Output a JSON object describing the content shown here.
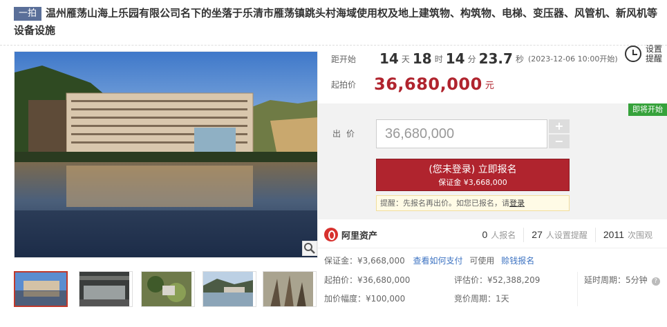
{
  "listing": {
    "tag": "一拍",
    "title": "温州雁荡山海上乐园有限公司名下的坐落于乐清市雁荡镇跳头村海域使用权及地上建筑物、构筑物、电梯、变压器、风管机、新风机等设备设施"
  },
  "countdown": {
    "label": "距开始",
    "days": "14",
    "days_unit": "天",
    "hours": "18",
    "hours_unit": "时",
    "minutes": "14",
    "minutes_unit": "分",
    "seconds": "23.7",
    "seconds_unit": "秒",
    "start_time": "(2023-12-06 10:00开始)"
  },
  "reminder": {
    "line1": "设置",
    "line2": "提醒",
    "icon": "alarm-clock-icon"
  },
  "start_price": {
    "label": "起拍价",
    "value": "36,680,000",
    "unit": "元"
  },
  "bid": {
    "badge": "即将开始",
    "label": "出价",
    "input_value": "36,680,000",
    "plus": "+",
    "minus": "−",
    "button_line1": "(您未登录) 立即报名",
    "button_line2": "保证金 ¥3,668,000",
    "notice_prefix": "提醒：先报名再出价。如您已报名，请",
    "notice_login": "登录"
  },
  "stats": {
    "logo_text": "阿里资产",
    "signups_count": "0",
    "signups_label": "人报名",
    "reminders_count": "27",
    "reminders_label": "人设置提醒",
    "views_count": "2011",
    "views_label": "次围观"
  },
  "info": {
    "deposit": "保证金：¥3,668,000",
    "how_to_pay": "查看如何支付",
    "usable": "可使用",
    "credit_signup": "赊钱报名",
    "start_price": "起拍价：¥36,680,000",
    "appraisal": "评估价：¥52,388,209",
    "delay_period": "延时周期：5分钟",
    "increment": "加价幅度：¥100,000",
    "bid_period": "竞价周期：1天"
  },
  "colors": {
    "accent": "#b0242e",
    "badge_green": "#36a23b",
    "link": "#3d73c2",
    "tag": "#5a6f99"
  }
}
